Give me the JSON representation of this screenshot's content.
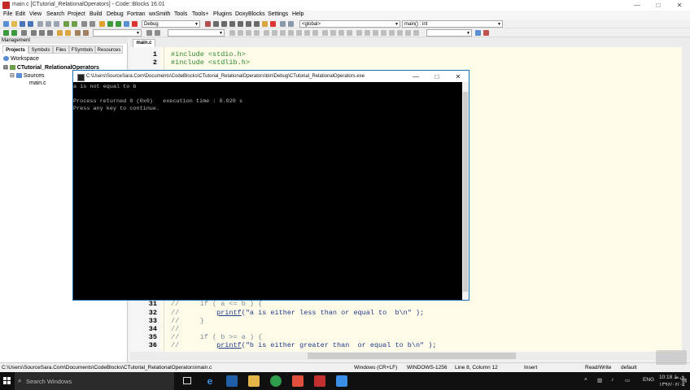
{
  "window": {
    "title": "main.c [CTutorial_RelationalOperators] - Code::Blocks 16.01",
    "minimize": "—",
    "maximize": "□",
    "close": "✕"
  },
  "menu": [
    "File",
    "Edit",
    "View",
    "Search",
    "Project",
    "Build",
    "Debug",
    "Fortran",
    "wxSmith",
    "Tools",
    "Tools+",
    "Plugins",
    "DoxyBlocks",
    "Settings",
    "Help"
  ],
  "toolbar": {
    "build_target": "Debug",
    "scope": "<global>",
    "function": "main() : int"
  },
  "management": {
    "header": "Management",
    "tabs": [
      "Projects",
      "Symbols",
      "Files",
      "FSymbols",
      "Resources"
    ],
    "workspace": "Workspace",
    "project": "CTutorial_RelationalOperators",
    "sources": "Sources",
    "file": "main.c"
  },
  "editor": {
    "tab": "main.c",
    "top_lines": [
      {
        "num": "1",
        "code": "#include <stdio.h>"
      },
      {
        "num": "2",
        "code": "#include <stdlib.h>"
      }
    ],
    "bottom_lines": [
      {
        "num": "31",
        "code": "//     if ( a <= b ) {"
      },
      {
        "num": "32",
        "pre": "//         ",
        "fn": "printf",
        "str": "(\"a is either less than or equal to  b\\n\" );"
      },
      {
        "num": "33",
        "code": "//     }"
      },
      {
        "num": "34",
        "code": "//"
      },
      {
        "num": "35",
        "code": "//     if ( b >= a ) {"
      },
      {
        "num": "36",
        "pre": "//         ",
        "fn": "printf",
        "str": "(\"b is either greater than  or equal to b\\n\" );"
      }
    ]
  },
  "console": {
    "title": "C:\\Users\\SourceSara.Com\\Documents\\CodeBlocks\\CTutorial_RelationalOperators\\bin\\Debug\\CTutorial_RelationalOperators.exe",
    "lines": [
      "a is not equal to b",
      "",
      "Process returned 0 (0x0)   execution time : 0.020 s",
      "Press any key to continue."
    ]
  },
  "status": {
    "path": "C:\\Users\\SourceSara.Com\\Documents\\CodeBlocks\\CTutorial_RelationalOperators\\main.c",
    "eol": "Windows (CR+LF)",
    "encoding": "WINDOWS-1256",
    "position": "Line 8, Column 12",
    "mode": "Insert",
    "access": "Read/Write",
    "profile": "default"
  },
  "taskbar": {
    "search": "Search Windows",
    "lang": "ENG",
    "time": "10:18 ق.ظ",
    "date": "۱۳۹۶/۰۶/۰۵"
  }
}
